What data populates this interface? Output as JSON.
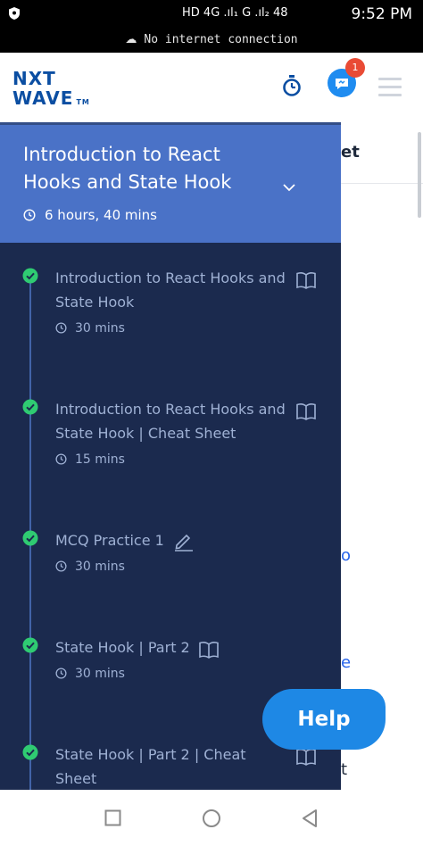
{
  "status_bar": {
    "time": "9:52 PM",
    "indicators": "HD 4G .ıl₁ G .ıl₂ 48",
    "left_icon": "shield-icon"
  },
  "offline_banner": {
    "text": "No internet connection",
    "icon": "cloud-off-icon"
  },
  "header": {
    "logo_line1": "NXT",
    "logo_line2": "WAVE",
    "logo_tm": "TM",
    "notification_count": "1",
    "brand_color": "#0b4ea2"
  },
  "drawer": {
    "title": "Introduction to React Hooks and State Hook",
    "duration": "6 hours, 40 mins",
    "header_color": "#4a72c7",
    "bg_color": "#1b2a4e",
    "items": [
      {
        "title": "Introduction to React Hooks and State Hook",
        "duration": "30 mins",
        "icon": "book-icon",
        "completed": true
      },
      {
        "title": "Introduction to React Hooks and State Hook | Cheat Sheet",
        "duration": "15 mins",
        "icon": "book-icon",
        "completed": true
      },
      {
        "title": "MCQ Practice 1",
        "duration": "30 mins",
        "icon": "edit-icon",
        "completed": true
      },
      {
        "title": "State Hook | Part 2",
        "duration": "30 mins",
        "icon": "book-icon",
        "completed": true
      },
      {
        "title": "State Hook | Part 2 | Cheat Sheet",
        "duration": "",
        "icon": "book-icon",
        "completed": true
      }
    ]
  },
  "background": {
    "tab_fragment": "et",
    "fragments": [
      "o",
      "e",
      "t"
    ]
  },
  "help_button": {
    "label": "Help"
  },
  "nav_bar": {
    "icons": [
      "recent-apps-icon",
      "home-icon",
      "back-icon"
    ]
  }
}
